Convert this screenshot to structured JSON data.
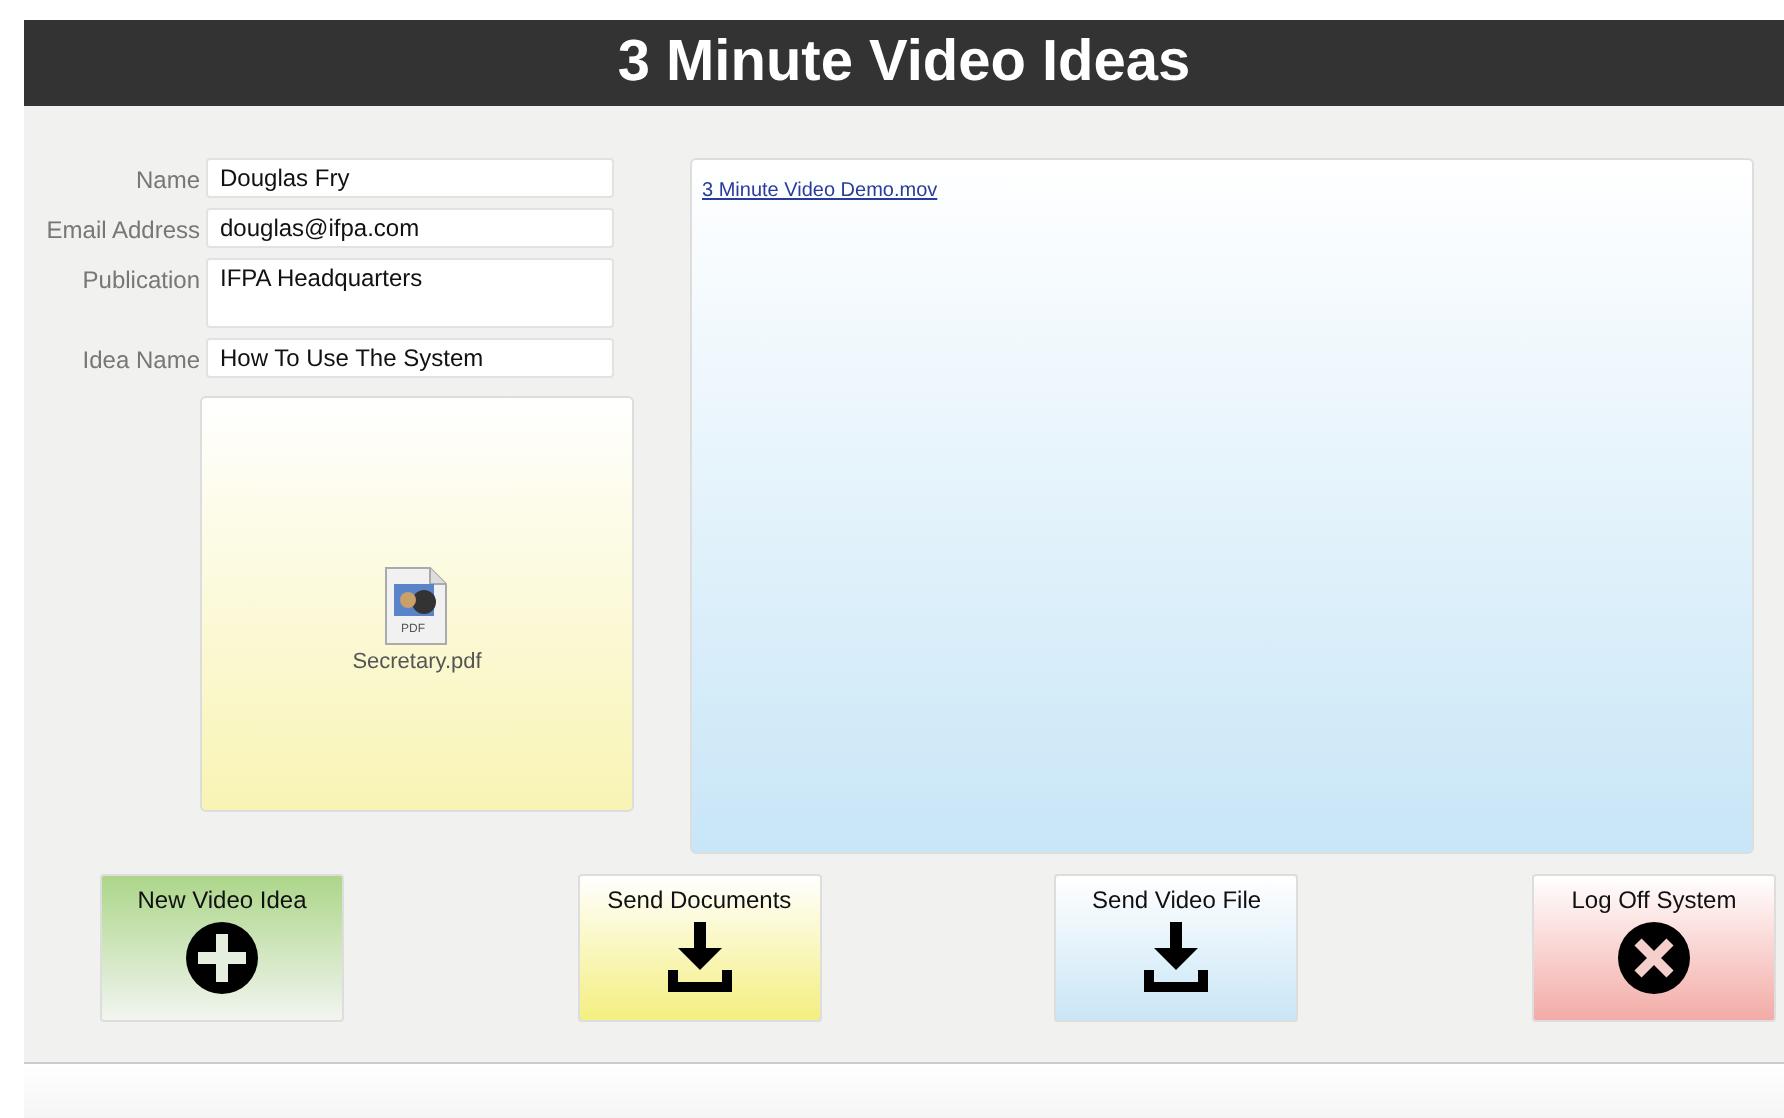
{
  "window": {
    "title": "3 Minute Video Ideas"
  },
  "form": {
    "fields": [
      {
        "label": "Name",
        "value": "Douglas Fry",
        "kind": "line"
      },
      {
        "label": "Email Address",
        "value": "douglas@ifpa.com",
        "kind": "line"
      },
      {
        "label": "Publication",
        "value": "IFPA Headquarters",
        "kind": "tall"
      },
      {
        "label": "Idea Name",
        "value": "How To Use The System",
        "kind": "line"
      }
    ],
    "attachment": {
      "file_name": "Secretary.pdf",
      "icon_label": "PDF"
    }
  },
  "video_panel": {
    "link": "3 Minute Video Demo.mov"
  },
  "buttons": [
    {
      "label": "New Video Idea",
      "kind": "add",
      "color": "#acd68a"
    },
    {
      "label": "Send Documents",
      "kind": "download",
      "color": "#f4ef80"
    },
    {
      "label": "Send Video File",
      "kind": "download",
      "color": "#c9e6f6"
    },
    {
      "label": "Log Off System",
      "kind": "close",
      "color": "#f3aba6"
    }
  ]
}
